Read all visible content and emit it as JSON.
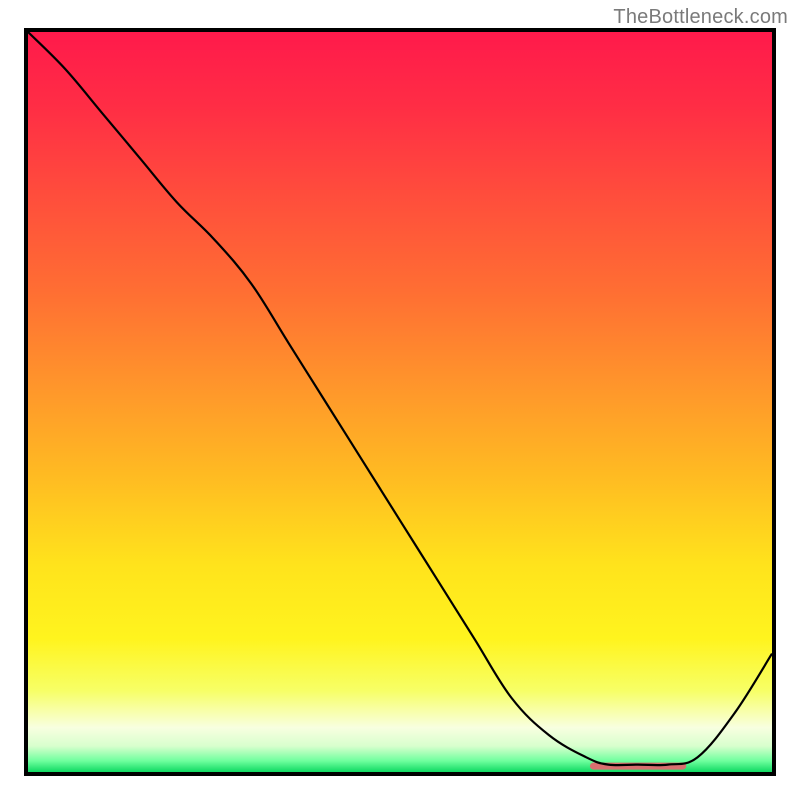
{
  "attribution": "TheBottleneck.com",
  "chart_data": {
    "type": "line",
    "title": "",
    "xlabel": "",
    "ylabel": "",
    "xlim": [
      0,
      100
    ],
    "ylim": [
      0,
      100
    ],
    "grid": false,
    "legend": false,
    "series": [
      {
        "name": "curve",
        "x": [
          0,
          5,
          10,
          15,
          20,
          25,
          30,
          35,
          40,
          45,
          50,
          55,
          60,
          65,
          70,
          75,
          78,
          82,
          86,
          90,
          95,
          100
        ],
        "y": [
          100,
          95,
          89,
          83,
          77,
          72,
          66,
          58,
          50,
          42,
          34,
          26,
          18,
          10,
          5,
          2,
          1,
          1,
          1,
          2,
          8,
          16
        ]
      }
    ],
    "flat_band": {
      "y_top": 4,
      "y_bottom": 1.5,
      "color_top": "#d8ffcd",
      "color_bottom": "#15e06a"
    },
    "trough_marker": {
      "x_start": 76,
      "x_end": 88,
      "y": 0.8,
      "color": "#d96f6f"
    },
    "gradient_stops": [
      {
        "offset": 0.0,
        "color": "#ff1a4b"
      },
      {
        "offset": 0.1,
        "color": "#ff2d45"
      },
      {
        "offset": 0.22,
        "color": "#ff4d3c"
      },
      {
        "offset": 0.35,
        "color": "#ff6e33"
      },
      {
        "offset": 0.48,
        "color": "#ff962b"
      },
      {
        "offset": 0.6,
        "color": "#ffbb22"
      },
      {
        "offset": 0.72,
        "color": "#ffe31c"
      },
      {
        "offset": 0.82,
        "color": "#fff41e"
      },
      {
        "offset": 0.89,
        "color": "#f7ff66"
      },
      {
        "offset": 0.94,
        "color": "#f8ffe0"
      },
      {
        "offset": 0.965,
        "color": "#d8ffcd"
      },
      {
        "offset": 0.985,
        "color": "#6fff9e"
      },
      {
        "offset": 1.0,
        "color": "#0fd962"
      }
    ]
  }
}
